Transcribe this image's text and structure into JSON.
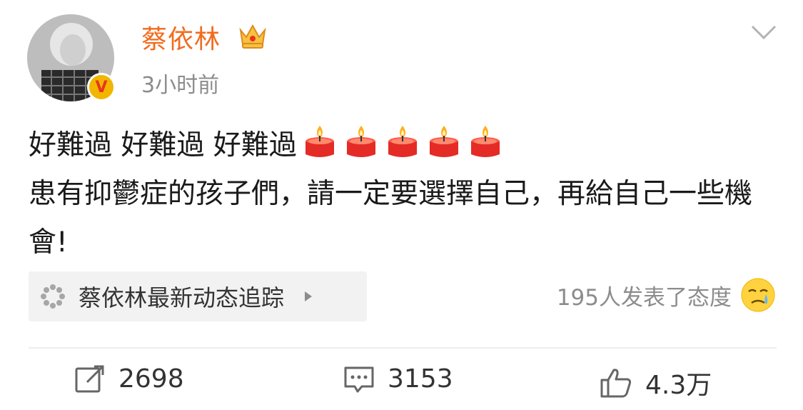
{
  "user": {
    "name": "蔡依林",
    "time": "3小时前",
    "verified_badge": "V"
  },
  "post": {
    "line1_text": "好難過 好難過 好難過",
    "line2_text": "患有抑鬱症的孩子們，請一定要選擇自己，再給自己一些機會!",
    "candle_count": 5
  },
  "topic": {
    "label": "蔡依林最新动态追踪",
    "icon": "loading-dots-icon"
  },
  "reactions": {
    "text": "195人发表了态度",
    "emoji": "crying-face-icon"
  },
  "actions": {
    "repost_count": "2698",
    "comment_count": "3153",
    "like_count": "4.3万"
  },
  "colors": {
    "username": "#f26b1d",
    "secondary_text": "#8c8c8c",
    "candle_red": "#e42b26",
    "badge_gold": "#f2b500"
  }
}
